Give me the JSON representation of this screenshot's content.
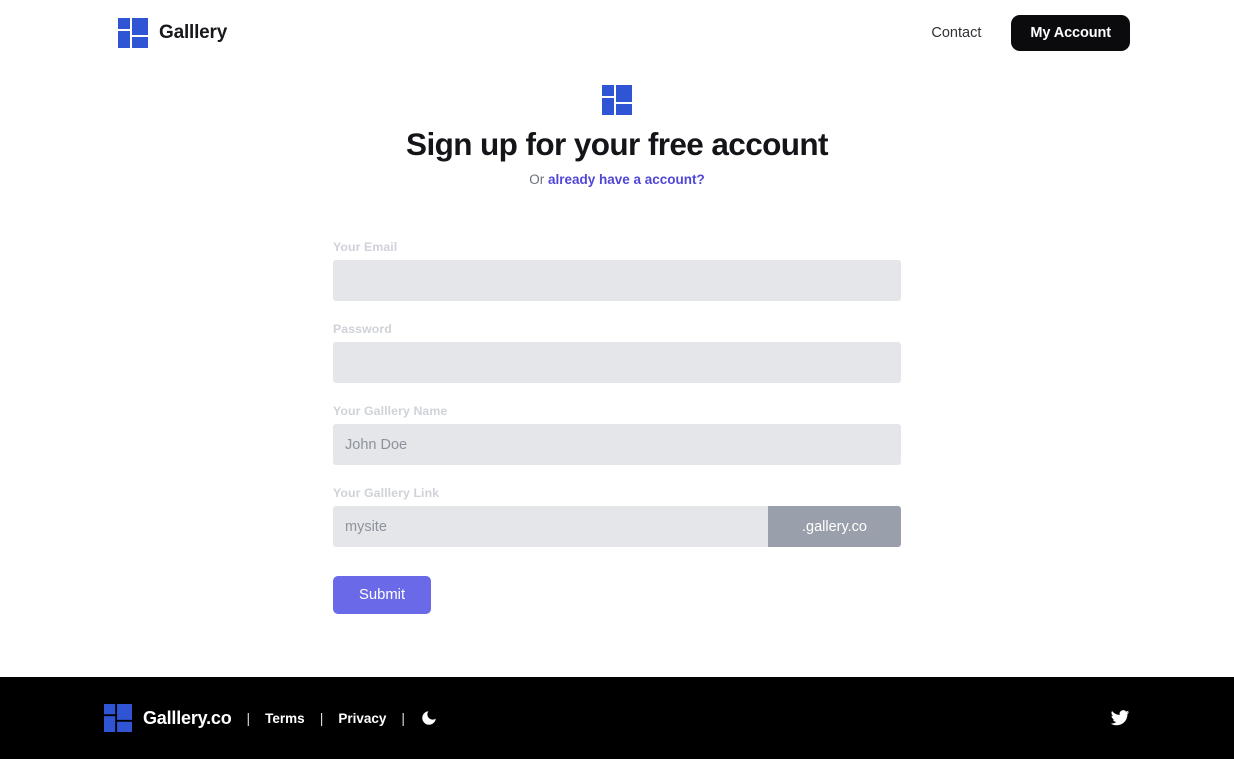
{
  "header": {
    "brand_name": "Galllery",
    "logo_icon": "galllery-grid-logo",
    "nav": {
      "contact_label": "Contact",
      "account_label": "My Account"
    }
  },
  "hero": {
    "logo_icon": "galllery-grid-logo",
    "title": "Sign up for your free account",
    "sub_prefix": "Or ",
    "sub_link": "already have a account?"
  },
  "form": {
    "fields": [
      {
        "label": "Your Email",
        "placeholder": "",
        "value": ""
      },
      {
        "label": "Password",
        "placeholder": "",
        "value": ""
      },
      {
        "label": "Your Galllery Name",
        "placeholder": "John Doe",
        "value": ""
      },
      {
        "label": "Your Galllery Link",
        "placeholder": "mysite",
        "value": "",
        "addon": ".gallery.co"
      }
    ],
    "submit_label": "Submit"
  },
  "footer": {
    "logo_icon": "galllery-grid-logo",
    "brand_name": "Galllery.co",
    "separator": "|",
    "terms_label": "Terms",
    "privacy_label": "Privacy",
    "dark_mode_icon": "moon-icon",
    "social_icon": "twitter-icon"
  },
  "colors": {
    "brand_blue": "#2f55d4",
    "accent_indigo": "#6a6ae8",
    "link_purple": "#4f46d8",
    "input_bg": "#e4e6e9",
    "addon_bg": "#9aa0ab",
    "footer_bg": "#000000",
    "button_black": "#0b0b0d"
  }
}
